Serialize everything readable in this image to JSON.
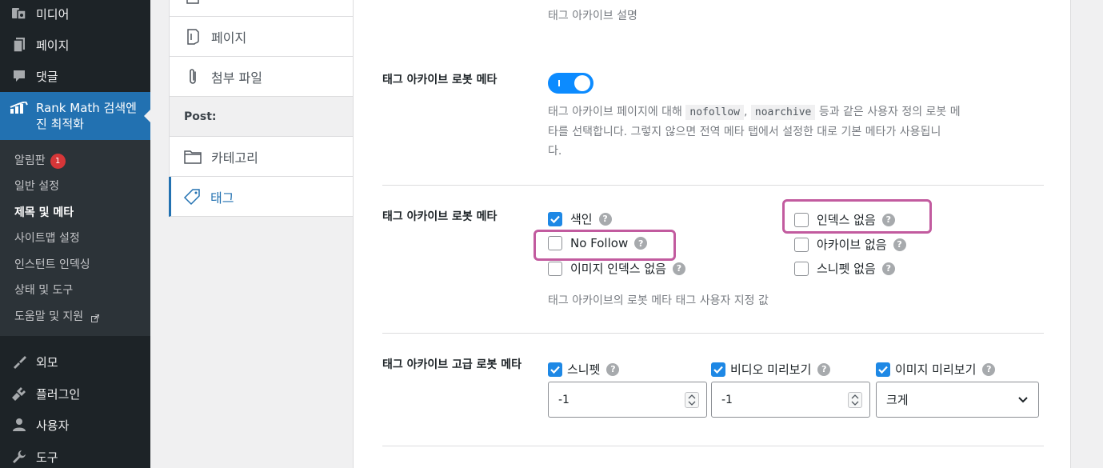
{
  "sidebar": {
    "items_top": [
      {
        "label": "미디어",
        "icon": "media-icon"
      },
      {
        "label": "페이지",
        "icon": "page-icon"
      },
      {
        "label": "댓글",
        "icon": "comment-icon"
      }
    ],
    "rank_math": {
      "label": "Rank Math 검색엔진 최적화",
      "icon": "rank-math-icon"
    },
    "submenu": [
      {
        "label": "알림판",
        "badge": "1"
      },
      {
        "label": "일반 설정"
      },
      {
        "label": "제목 및 메타",
        "current": true
      },
      {
        "label": "사이트맵 설정"
      },
      {
        "label": "인스턴트 인덱싱"
      },
      {
        "label": "상태 및 도구"
      },
      {
        "label": "도움말 및 지원",
        "external": true
      }
    ],
    "items_bottom": [
      {
        "label": "외모",
        "icon": "brush-icon"
      },
      {
        "label": "플러그인",
        "icon": "plugin-icon"
      },
      {
        "label": "사용자",
        "icon": "user-icon"
      },
      {
        "label": "도구",
        "icon": "wrench-icon"
      }
    ]
  },
  "tabs": {
    "top_partial": "",
    "pages": "페이지",
    "attachments": "첨부 파일",
    "group_post": "Post:",
    "categories": "카테고리",
    "tags": "태그"
  },
  "main": {
    "tag_archive_desc": "태그 아카이브 설명",
    "robots_meta_toggle": {
      "label": "태그 아카이브 로봇 메타",
      "state": "on",
      "desc_part1": "태그 아카이브 페이지에 대해",
      "code1": "nofollow",
      "comma": ",",
      "code2": "noarchive",
      "desc_part2": "등과 같은 사용자 정의 로봇 메",
      "desc_line2": "타를 선택합니다. 그렇지 않으면 전역 메타 탭에서 설정한 대로 기본 메타가 사용됩니",
      "desc_line3": "다."
    },
    "robots_meta": {
      "label": "태그 아카이브 로봇 메타",
      "index": {
        "label": "색인",
        "checked": true
      },
      "noindex": {
        "label": "인덱스 없음",
        "checked": false
      },
      "nofollow": {
        "label": "No Follow",
        "checked": false
      },
      "noarchive": {
        "label": "아카이브 없음",
        "checked": false
      },
      "noimageindex": {
        "label": "이미지 인덱스 없음",
        "checked": false
      },
      "nosnippet": {
        "label": "스니펫 없음",
        "checked": false
      },
      "desc": "태그 아카이브의 로봇 메타 태그 사용자 지정 값",
      "help": "?"
    },
    "advanced_robots": {
      "label": "태그 아카이브 고급 로봇 메타",
      "snippet": {
        "label": "스니펫",
        "checked": true,
        "value": "-1"
      },
      "video_preview": {
        "label": "비디오 미리보기",
        "checked": true,
        "value": "-1"
      },
      "image_preview": {
        "label": "이미지 미리보기",
        "checked": true,
        "value": "크게"
      }
    }
  },
  "colors": {
    "admin_bg": "#1d2327",
    "accent": "#2271b1",
    "toggle_on": "#0c8bff",
    "highlight": "#c25b9f"
  }
}
